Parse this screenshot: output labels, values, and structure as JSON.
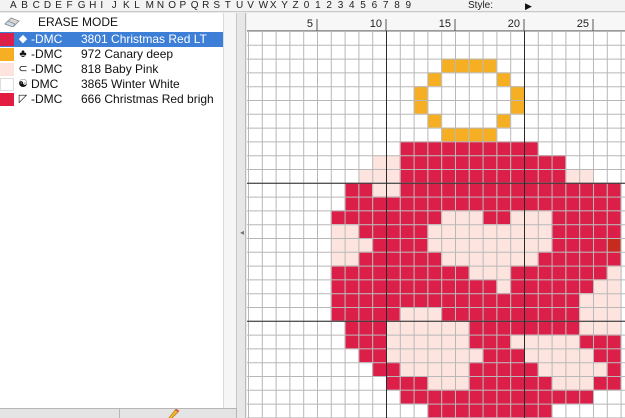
{
  "symbol_bar": {
    "symbols": [
      "A",
      "B",
      "C",
      "D",
      "E",
      "F",
      "G",
      "H",
      "I",
      "J",
      "K",
      "L",
      "M",
      "N",
      "O",
      "P",
      "Q",
      "R",
      "S",
      "T",
      "U",
      "V",
      "W",
      "X",
      "Y",
      "Z",
      "0",
      "1",
      "2",
      "3",
      "4",
      "5",
      "6",
      "7",
      "8",
      "9"
    ],
    "style_label": "Style:",
    "style_arrow": "▶"
  },
  "floss_panel": {
    "erase_label": "ERASE MODE",
    "items": [
      {
        "prefix": "-DMC",
        "code": "3801",
        "name": "Christmas Red LT",
        "color": "#dc1f48",
        "symbol": "◆",
        "selected": true
      },
      {
        "prefix": "-DMC",
        "code": "972",
        "name": "Canary deep",
        "color": "#f6ae22",
        "symbol": "♣",
        "selected": false
      },
      {
        "prefix": "-DMC",
        "code": "818",
        "name": "Baby Pink",
        "color": "#fde4de",
        "symbol": "⊂",
        "selected": false
      },
      {
        "prefix": "DMC",
        "code": "3865",
        "name": "Winter White",
        "color": "#ffffff",
        "symbol": "☯",
        "selected": false
      },
      {
        "prefix": "-DMC",
        "code": "666",
        "name": "Christmas Red brigh",
        "color": "#e31d42",
        "symbol": "◸",
        "selected": false
      }
    ]
  },
  "ruler": {
    "labels": [
      "5",
      "10",
      "15",
      "20",
      "25"
    ]
  },
  "colors": {
    "red": "#dc1f48",
    "gold": "#f6ae22",
    "pink": "#fde4de",
    "accent_red": "#c92a20",
    "grid_line": "#b8b8b8",
    "grid_major": "#2a2a2a",
    "selection": "#3d7ed7"
  },
  "pattern": {
    "legend": {
      "R": "red",
      "Y": "gold",
      "P": "pink",
      "X": "accent_red"
    },
    "rows": [
      "                          ",
      "                          ",
      "             YYYY         ",
      "            Y    Y        ",
      "           Y      Y       ",
      "           Y      Y       ",
      "            Y    Y        ",
      "             YYYY         ",
      "          RRRRRRRRRR      ",
      "        PPRRRRRRRRRRRR    ",
      "       PPPRRRRRRRRRRRRPP  ",
      "      RRPPRRRRRRRRRRRRRRRR",
      "      RRRRRRRRRRRRRRRRRRRR",
      "     RRRRRRRRPPPRRPPPRRRRR",
      "     PPRRRRRPPPPPPPPPRRRRR",
      "     PPPRRRRPPPPPPPPPRRRRX",
      "     PPRRRRRRPPPPPPPRRRRRR",
      "     RRRRRRRRRRPPPRRRRRRRP",
      "     RRRRRRRRRRRRPRRRRRRPP",
      "     RRRRRRRRRRRRRRRRRRPPP",
      "     RRRRRPPPRRRRRRRRRRPPP",
      "      RRRPPPPPPRRRRRRRRPPP",
      "      RRRPPPPPPRRRPPPPPRRR",
      "       RRPPPPPPPRRRPPPPPRR",
      "        RRPPPPPRRRRRPPPPPR",
      "         RRRPPPRRRRRRPPPRR",
      "          RRRRRRRRRRRRRR  ",
      "            RRRRRRRRR     "
    ]
  }
}
